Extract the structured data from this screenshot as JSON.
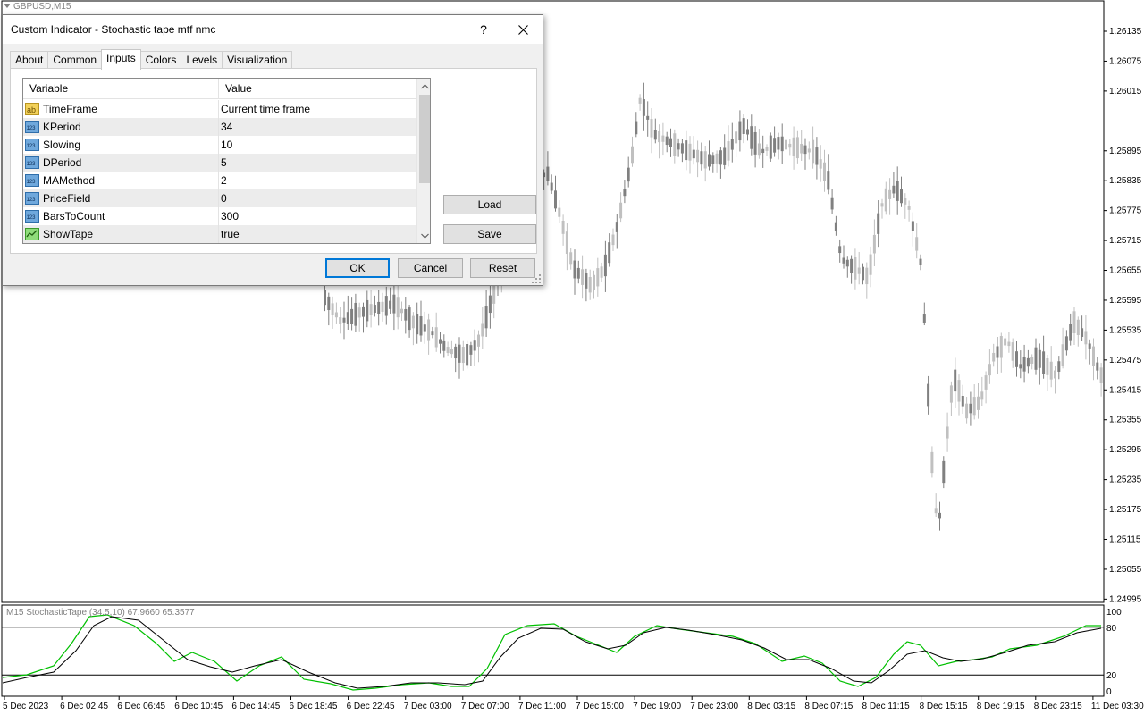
{
  "chart": {
    "title": "GBPUSD,M15",
    "symbol_tf": "GBPUSD,M15",
    "price_axis": [
      "1.26135",
      "1.26075",
      "1.26015",
      "1.25895",
      "1.25835",
      "1.25775",
      "1.25715",
      "1.25655",
      "1.25595",
      "1.25535",
      "1.25475",
      "1.25415",
      "1.25355",
      "1.25295",
      "1.25235",
      "1.25175",
      "1.25115",
      "1.25055",
      "1.24995"
    ],
    "time_axis": [
      "5 Dec 2023",
      "6 Dec 02:45",
      "6 Dec 06:45",
      "6 Dec 10:45",
      "6 Dec 14:45",
      "6 Dec 18:45",
      "6 Dec 22:45",
      "7 Dec 03:00",
      "7 Dec 07:00",
      "7 Dec 11:00",
      "7 Dec 15:00",
      "7 Dec 19:00",
      "7 Dec 23:00",
      "8 Dec 03:15",
      "8 Dec 07:15",
      "8 Dec 11:15",
      "8 Dec 15:15",
      "8 Dec 19:15",
      "8 Dec 23:15",
      "11 Dec 03:30"
    ],
    "oscillator": {
      "title": "M15 StochasticTape (34,5,10) 67.9660 65.3577",
      "levels": [
        "100",
        "80",
        "20",
        "0"
      ],
      "green_color": "#00c000",
      "black_color": "#000000"
    },
    "candle_color_bull": "#c0c0c0",
    "candle_color_bear": "#808080"
  },
  "dialog": {
    "title": "Custom Indicator - Stochastic tape mtf nmc",
    "help_label": "?",
    "tabs": [
      "About",
      "Common",
      "Inputs",
      "Colors",
      "Levels",
      "Visualization"
    ],
    "active_tab": "Inputs",
    "grid": {
      "header_variable": "Variable",
      "header_value": "Value",
      "rows": [
        {
          "name": "TimeFrame",
          "value": "Current time frame",
          "icon": "string-ab-icon"
        },
        {
          "name": "KPeriod",
          "value": "34",
          "icon": "integer-123-icon"
        },
        {
          "name": "Slowing",
          "value": "10",
          "icon": "integer-123-icon"
        },
        {
          "name": "DPeriod",
          "value": "5",
          "icon": "integer-123-icon"
        },
        {
          "name": "MAMethod",
          "value": "2",
          "icon": "integer-123-icon"
        },
        {
          "name": "PriceField",
          "value": "0",
          "icon": "integer-123-icon"
        },
        {
          "name": "BarsToCount",
          "value": "300",
          "icon": "integer-123-icon"
        },
        {
          "name": "ShowTape",
          "value": "true",
          "icon": "boolean-chart-icon"
        }
      ]
    },
    "buttons": {
      "load": "Load",
      "save": "Save",
      "ok": "OK",
      "cancel": "Cancel",
      "reset": "Reset"
    },
    "accent_color": "#0078d7"
  }
}
